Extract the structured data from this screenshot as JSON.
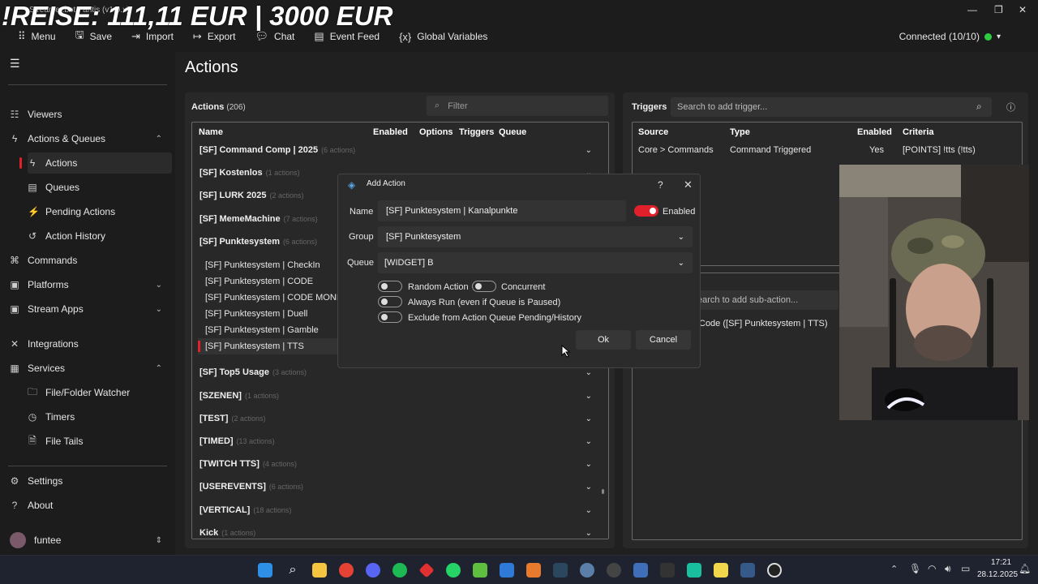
{
  "overlay_text": "!REISE: 111,11 EUR | 3000 EUR",
  "window_caption": "Streamer.bot - antis (v1.0.x)",
  "menu": [
    "Menu",
    "Save",
    "Import",
    "Export",
    "Chat",
    "Event Feed",
    "Global Variables"
  ],
  "connection": {
    "label": "Connected (10/10)",
    "status_color": "#2ecc40"
  },
  "sidebar": {
    "items": [
      {
        "label": "Viewers",
        "icon": "viewers-icon"
      },
      {
        "label": "Actions & Queues",
        "icon": "bolt-icon"
      },
      {
        "label": "Actions",
        "icon": "bolt-icon"
      },
      {
        "label": "Queues",
        "icon": "queue-icon"
      },
      {
        "label": "Pending Actions",
        "icon": "pending-icon"
      },
      {
        "label": "Action History",
        "icon": "history-icon"
      },
      {
        "label": "Commands",
        "icon": "command-icon"
      },
      {
        "label": "Platforms",
        "icon": "platforms-icon"
      },
      {
        "label": "Stream Apps",
        "icon": "apps-icon"
      },
      {
        "label": "Integrations",
        "icon": "integrations-icon"
      },
      {
        "label": "Services",
        "icon": "services-icon"
      },
      {
        "label": "File/Folder Watcher",
        "icon": "folder-icon"
      },
      {
        "label": "Timers",
        "icon": "timer-icon"
      },
      {
        "label": "File Tails",
        "icon": "file-icon"
      },
      {
        "label": "Settings",
        "icon": "gear-icon"
      },
      {
        "label": "About",
        "icon": "help-icon"
      }
    ],
    "user": "funtee"
  },
  "page_title": "Actions",
  "actions_panel": {
    "title": "Actions",
    "count": "(206)",
    "filter_placeholder": "Filter",
    "columns": [
      "Name",
      "Enabled",
      "Options",
      "Triggers",
      "Queue"
    ],
    "groups_top": [
      {
        "name": "[SF] Command Comp | 2025",
        "count": "(6 actions)"
      },
      {
        "name": "[SF] Kostenlos",
        "count": "(1 actions)"
      },
      {
        "name": "[SF] LURK 2025",
        "count": "(2 actions)"
      },
      {
        "name": "[SF] MemeMachine",
        "count": "(7 actions)"
      },
      {
        "name": "[SF] Punktesystem",
        "count": "(6 actions)"
      }
    ],
    "sub_actions": [
      "[SF] Punktesystem | CheckIn",
      "[SF] Punktesystem | CODE",
      "[SF] Punktesystem | CODE MONITÄ",
      "[SF] Punktesystem | Duell",
      "[SF] Punktesystem | Gamble",
      "[SF] Punktesystem | TTS"
    ],
    "groups_bottom": [
      {
        "name": "[SF] Top5 Usage",
        "count": "(3 actions)"
      },
      {
        "name": "[SZENEN]",
        "count": "(1 actions)"
      },
      {
        "name": "[TEST]",
        "count": "(2 actions)"
      },
      {
        "name": "[TIMED]",
        "count": "(13 actions)"
      },
      {
        "name": "[TWITCH TTS]",
        "count": "(4 actions)"
      },
      {
        "name": "[USEREVENTS]",
        "count": "(6 actions)"
      },
      {
        "name": "[VERTICAL]",
        "count": "(18 actions)"
      },
      {
        "name": "Kick",
        "count": "(1 actions)"
      }
    ]
  },
  "triggers_panel": {
    "title": "Triggers",
    "search_placeholder": "Search to add trigger...",
    "columns": [
      "Source",
      "Type",
      "Enabled",
      "Criteria"
    ],
    "row": {
      "source": "Core > Commands",
      "type": "Command Triggered",
      "enabled": "Yes",
      "criteria": "[POINTS] !tts (!tts)"
    },
    "subaction_search": "earch to add sub-action...",
    "subaction_row": "Code ([SF] Punktesystem | TTS)"
  },
  "dialog": {
    "title": "Add Action",
    "name_label": "Name",
    "name_value": "[SF] Punktesystem | Kanalpunkte",
    "enabled_label": "Enabled",
    "group_label": "Group",
    "group_value": "[SF] Punktesystem",
    "queue_label": "Queue",
    "queue_value": "[WIDGET] B",
    "random_action": "Random Action",
    "concurrent": "Concurrent",
    "always_run": "Always Run (even if Queue is Paused)",
    "exclude": "Exclude from Action Queue Pending/History",
    "ok": "Ok",
    "cancel": "Cancel",
    "enabled_on": true
  },
  "tray": {
    "time": "17:21",
    "date": "28.12.2025"
  },
  "accent_color": "#e0202a"
}
